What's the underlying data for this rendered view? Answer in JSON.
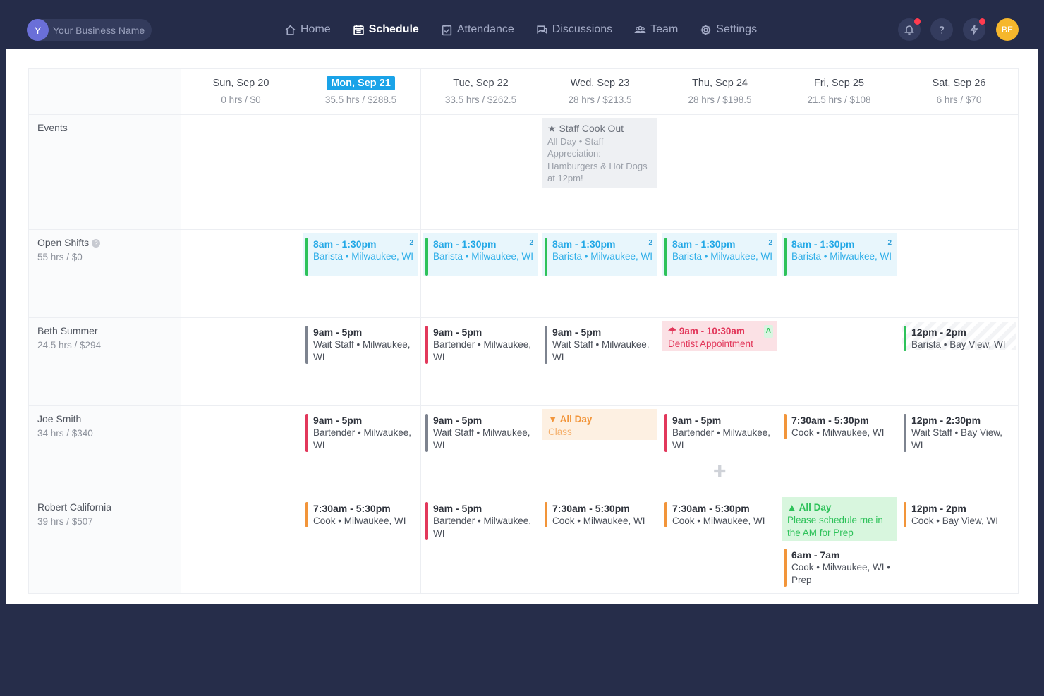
{
  "business": {
    "avatar_letter": "Y",
    "name": "Your Business Name"
  },
  "nav": [
    {
      "label": "Home",
      "icon": "home-icon"
    },
    {
      "label": "Schedule",
      "icon": "calendar-icon",
      "active": true
    },
    {
      "label": "Attendance",
      "icon": "clipboard-icon"
    },
    {
      "label": "Discussions",
      "icon": "chat-icon"
    },
    {
      "label": "Team",
      "icon": "team-icon"
    },
    {
      "label": "Settings",
      "icon": "gear-icon"
    }
  ],
  "user": {
    "initials": "BE"
  },
  "days": [
    {
      "name": "Sun, Sep 20",
      "summary": "0 hrs / $0"
    },
    {
      "name": "Mon, Sep 21",
      "summary": "35.5 hrs / $288.5",
      "today": true
    },
    {
      "name": "Tue, Sep 22",
      "summary": "33.5 hrs / $262.5"
    },
    {
      "name": "Wed, Sep 23",
      "summary": "28 hrs / $213.5"
    },
    {
      "name": "Thu, Sep 24",
      "summary": "28 hrs / $198.5"
    },
    {
      "name": "Fri, Sep 25",
      "summary": "21.5 hrs / $108"
    },
    {
      "name": "Sat, Sep 26",
      "summary": "6 hrs / $70"
    }
  ],
  "rows": {
    "events": {
      "label": "Events"
    },
    "open": {
      "label": "Open Shifts",
      "summary": "55 hrs / $0"
    },
    "beth": {
      "label": "Beth Summer",
      "summary": "24.5 hrs / $294"
    },
    "joe": {
      "label": "Joe Smith",
      "summary": "34 hrs / $340"
    },
    "robert": {
      "label": "Robert California",
      "summary": "39 hrs / $507"
    }
  },
  "event": {
    "title": "Staff Cook Out",
    "desc": "All Day • Staff Appreciation: Hamburgers & Hot Dogs at 12pm!"
  },
  "open_shift": {
    "time": "8am - 1:30pm",
    "desc": "Barista • Milwaukee, WI",
    "count": "2"
  },
  "shifts": {
    "beth_mon": {
      "time": "9am - 5pm",
      "desc": "Wait Staff • Milwaukee, WI"
    },
    "beth_tue": {
      "time": "9am - 5pm",
      "desc": "Bartender • Milwaukee, WI"
    },
    "beth_wed": {
      "time": "9am - 5pm",
      "desc": "Wait Staff • Milwaukee, WI"
    },
    "beth_thu": {
      "time": "9am - 10:30am",
      "desc": "Dentist Appointment",
      "badge": "A"
    },
    "beth_sat": {
      "time": "12pm - 2pm",
      "desc": "Barista • Bay View, WI"
    },
    "joe_mon": {
      "time": "9am - 5pm",
      "desc": "Bartender • Milwaukee, WI"
    },
    "joe_tue": {
      "time": "9am - 5pm",
      "desc": "Wait Staff • Milwaukee, WI"
    },
    "joe_wed": {
      "time": "All Day",
      "desc": "Class"
    },
    "joe_thu": {
      "time": "9am - 5pm",
      "desc": "Bartender • Milwaukee, WI"
    },
    "joe_fri": {
      "time": "7:30am - 5:30pm",
      "desc": "Cook • Milwaukee, WI"
    },
    "joe_sat": {
      "time": "12pm - 2:30pm",
      "desc": "Wait Staff • Bay View, WI"
    },
    "rob_mon": {
      "time": "7:30am - 5:30pm",
      "desc": "Cook • Milwaukee, WI"
    },
    "rob_tue": {
      "time": "9am - 5pm",
      "desc": "Bartender • Milwaukee, WI"
    },
    "rob_wed": {
      "time": "7:30am - 5:30pm",
      "desc": "Cook • Milwaukee, WI"
    },
    "rob_thu": {
      "time": "7:30am - 5:30pm",
      "desc": "Cook • Milwaukee, WI"
    },
    "rob_fri_req": {
      "time": "All Day",
      "desc": "Please schedule me in the AM for Prep"
    },
    "rob_fri": {
      "time": "6am - 7am",
      "desc": "Cook • Milwaukee, WI • Prep"
    },
    "rob_sat": {
      "time": "12pm - 2pm",
      "desc": "Cook • Bay View, WI"
    }
  },
  "colors": {
    "green": "#2ec25a",
    "gray": "#7d838f",
    "red": "#e2385b",
    "orange": "#f2953a",
    "blue": "#23a8e6"
  }
}
